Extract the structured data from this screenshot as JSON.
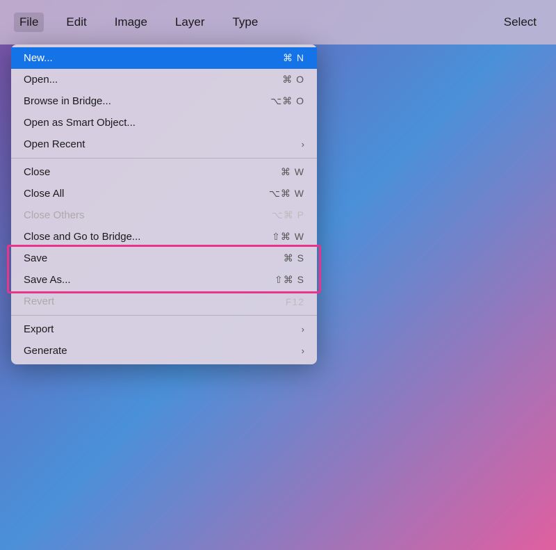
{
  "menubar": {
    "items": [
      {
        "label": "File",
        "id": "file",
        "active": true
      },
      {
        "label": "Edit",
        "id": "edit"
      },
      {
        "label": "Image",
        "id": "image"
      },
      {
        "label": "Layer",
        "id": "layer"
      },
      {
        "label": "Type",
        "id": "type"
      },
      {
        "label": "Select",
        "id": "select"
      }
    ]
  },
  "dropdown": {
    "items": [
      {
        "id": "new",
        "label": "New...",
        "shortcut": "⌘ N",
        "highlighted": true,
        "disabled": false,
        "hasArrow": false
      },
      {
        "id": "open",
        "label": "Open...",
        "shortcut": "⌘ O",
        "highlighted": false,
        "disabled": false,
        "hasArrow": false
      },
      {
        "id": "browse-bridge",
        "label": "Browse in Bridge...",
        "shortcut": "⌥⌘ O",
        "highlighted": false,
        "disabled": false,
        "hasArrow": false
      },
      {
        "id": "open-smart",
        "label": "Open as Smart Object...",
        "shortcut": "",
        "highlighted": false,
        "disabled": false,
        "hasArrow": false
      },
      {
        "id": "open-recent",
        "label": "Open Recent",
        "shortcut": "",
        "highlighted": false,
        "disabled": false,
        "hasArrow": true
      },
      {
        "id": "divider1",
        "type": "divider"
      },
      {
        "id": "close",
        "label": "Close",
        "shortcut": "⌘ W",
        "highlighted": false,
        "disabled": false,
        "hasArrow": false
      },
      {
        "id": "close-all",
        "label": "Close All",
        "shortcut": "⌥⌘ W",
        "highlighted": false,
        "disabled": false,
        "hasArrow": false
      },
      {
        "id": "close-others",
        "label": "Close Others",
        "shortcut": "⌥⌘ P",
        "highlighted": false,
        "disabled": true,
        "hasArrow": false
      },
      {
        "id": "close-bridge",
        "label": "Close and Go to Bridge...",
        "shortcut": "⇧⌘ W",
        "highlighted": false,
        "disabled": false,
        "hasArrow": false
      },
      {
        "id": "save",
        "label": "Save",
        "shortcut": "⌘ S",
        "highlighted": false,
        "disabled": false,
        "hasArrow": false
      },
      {
        "id": "save-as",
        "label": "Save As...",
        "shortcut": "⇧⌘ S",
        "highlighted": false,
        "disabled": false,
        "hasArrow": false
      },
      {
        "id": "revert",
        "label": "Revert",
        "shortcut": "F12",
        "highlighted": false,
        "disabled": true,
        "hasArrow": false
      },
      {
        "id": "divider2",
        "type": "divider"
      },
      {
        "id": "export",
        "label": "Export",
        "shortcut": "",
        "highlighted": false,
        "disabled": false,
        "hasArrow": true
      },
      {
        "id": "generate",
        "label": "Generate",
        "shortcut": "",
        "highlighted": false,
        "disabled": false,
        "hasArrow": true
      }
    ]
  },
  "pink_outline": {
    "label": "Save As highlighted box"
  }
}
